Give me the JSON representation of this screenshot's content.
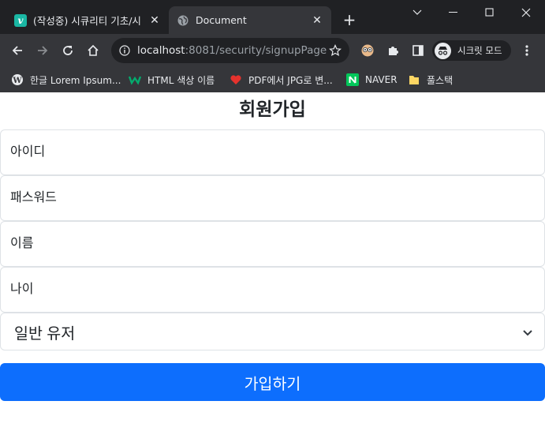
{
  "browser": {
    "tabs": [
      {
        "title": "(작성중) 시큐리티 기초/시",
        "icon": "velog-icon",
        "active": false
      },
      {
        "title": "Document",
        "icon": "globe-icon",
        "active": true
      }
    ],
    "url_host": "localhost",
    "url_rest": ":8081/security/signupPage",
    "incognito_label": "시크릿 모드",
    "bookmarks": [
      {
        "label": "한글 Lorem Ipsum...",
        "icon": "wordpress-icon"
      },
      {
        "label": "HTML 색상 이름",
        "icon": "w-logo-icon"
      },
      {
        "label": "PDF에서 JPG로 변...",
        "icon": "pdf-heart-icon"
      },
      {
        "label": "NAVER",
        "icon": "naver-icon"
      },
      {
        "label": "풀스택",
        "icon": "folder-icon"
      }
    ]
  },
  "signup": {
    "title": "회원가입",
    "fields": {
      "username_placeholder": "아이디",
      "password_placeholder": "패스워드",
      "name_placeholder": "이름",
      "age_placeholder": "나이"
    },
    "role_selected": "일반 유저",
    "submit_label": "가입하기"
  },
  "colors": {
    "primary": "#0d6efd",
    "chrome_dark": "#202124",
    "chrome_toolbar": "#35363a"
  }
}
